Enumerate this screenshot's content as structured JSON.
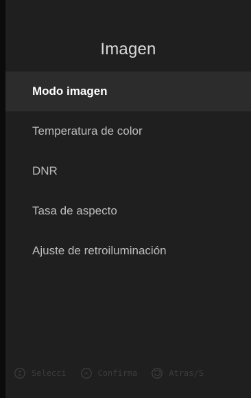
{
  "screen": {
    "title": "Imagen"
  },
  "menu": {
    "items": [
      {
        "label": "Modo imagen",
        "selected": true
      },
      {
        "label": "Temperatura de color",
        "selected": false
      },
      {
        "label": "DNR",
        "selected": false
      },
      {
        "label": "Tasa de aspecto",
        "selected": false
      },
      {
        "label": "Ajuste de retroiluminación",
        "selected": false
      }
    ]
  },
  "hints": [
    {
      "icon": "dpad-updown-icon",
      "label": "Selecci"
    },
    {
      "icon": "ok-button-icon",
      "label": "Confirma"
    },
    {
      "icon": "back-arrow-icon",
      "label": "Atras/S"
    }
  ],
  "colors": {
    "panel_bg": "#1f1f1f",
    "selected_bg": "#2c2c2c",
    "text": "#bdbdbd",
    "selected_text": "#ffffff",
    "hint_text": "#3c3c3c"
  }
}
